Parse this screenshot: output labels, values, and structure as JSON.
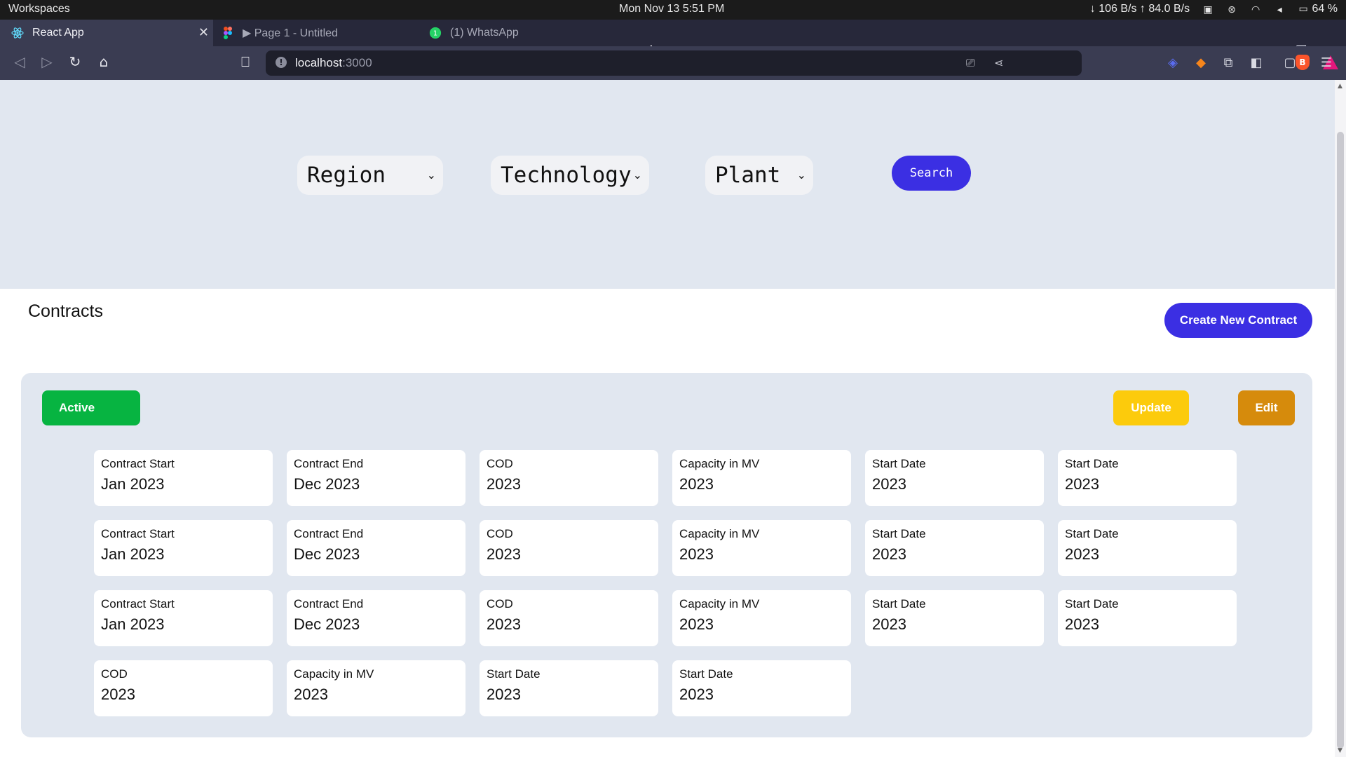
{
  "os": {
    "workspaces": "Workspaces",
    "clock": "Mon Nov 13   5:51 PM",
    "network": "↓ 106 B/s ↑ 84.0 B/s",
    "battery": "64 %"
  },
  "tabs": [
    {
      "title": "React App",
      "icon": "react-icon"
    },
    {
      "title": "▶ Page 1 - Untitled",
      "icon": "figma-icon"
    },
    {
      "title": "(1) WhatsApp",
      "icon": "whatsapp-icon"
    }
  ],
  "address": {
    "host": "localhost",
    "port": ":3000"
  },
  "filters": {
    "region": "Region",
    "technology": "Technology",
    "plant": "Plant",
    "search_label": "Search"
  },
  "contracts": {
    "title": "Contracts",
    "create_label": "Create New Contract",
    "status_label": "Active",
    "update_label": "Update",
    "edit_label": "Edit",
    "rows": [
      [
        {
          "label": "Contract Start",
          "value": "Jan 2023"
        },
        {
          "label": "Contract End",
          "value": "Dec 2023"
        },
        {
          "label": "COD",
          "value": "2023"
        },
        {
          "label": "Capacity in MV",
          "value": "2023"
        },
        {
          "label": "Start Date",
          "value": "2023"
        },
        {
          "label": "Start Date",
          "value": "2023"
        }
      ],
      [
        {
          "label": "Contract Start",
          "value": "Jan 2023"
        },
        {
          "label": "Contract End",
          "value": "Dec 2023"
        },
        {
          "label": "COD",
          "value": "2023"
        },
        {
          "label": "Capacity in MV",
          "value": "2023"
        },
        {
          "label": "Start Date",
          "value": "2023"
        },
        {
          "label": "Start Date",
          "value": "2023"
        }
      ],
      [
        {
          "label": "Contract Start",
          "value": "Jan 2023"
        },
        {
          "label": "Contract End",
          "value": "Dec 2023"
        },
        {
          "label": "COD",
          "value": "2023"
        },
        {
          "label": "Capacity in MV",
          "value": "2023"
        },
        {
          "label": "Start Date",
          "value": "2023"
        },
        {
          "label": "Start Date",
          "value": "2023"
        }
      ],
      [
        {
          "label": "COD",
          "value": "2023"
        },
        {
          "label": "Capacity in MV",
          "value": "2023"
        },
        {
          "label": "Start Date",
          "value": "2023"
        },
        {
          "label": "Start Date",
          "value": "2023"
        }
      ]
    ]
  },
  "colors": {
    "primary": "#3b2fe3",
    "active": "#07b441",
    "update": "#fccb0c",
    "edit": "#d68b0c",
    "band": "#e1e7f0"
  }
}
